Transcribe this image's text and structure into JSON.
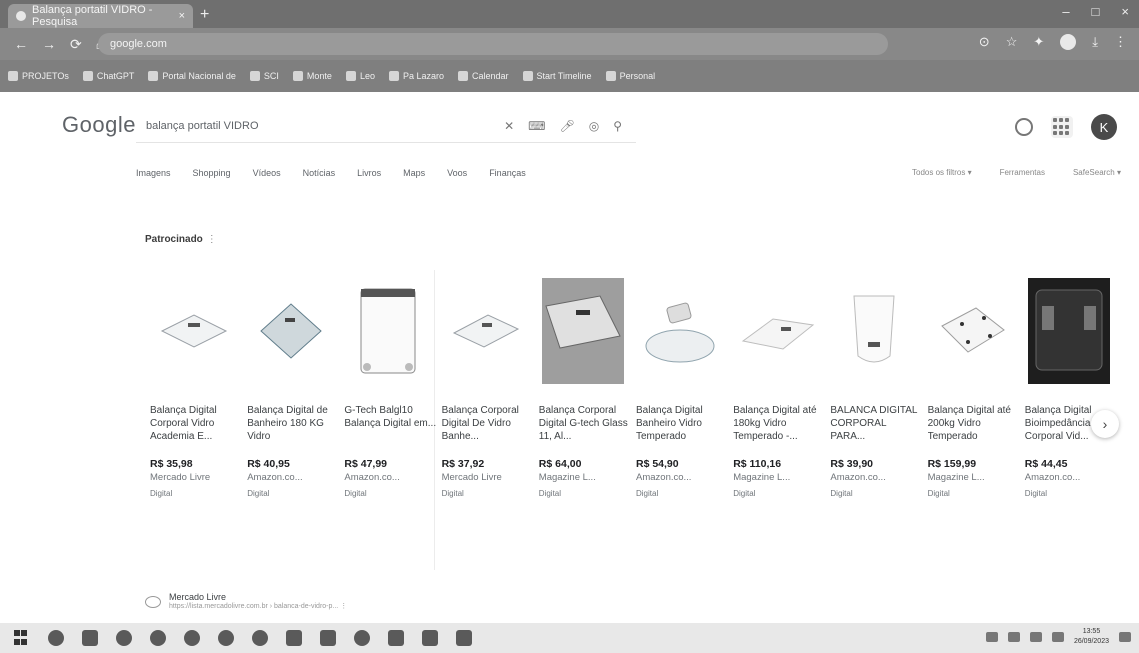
{
  "browser": {
    "tab_title": "Balança portatil VIDRO - Pesquisa",
    "tab_close": "×",
    "new_tab": "+",
    "url": "google.com",
    "window_controls": [
      "–",
      "□",
      "×"
    ],
    "bookmarks": [
      "PROJETOs",
      "ChatGPT",
      "Portal Nacional de",
      "SCI",
      "Monte",
      "Leo",
      "Pa Lazaro",
      "Calendar",
      "Start Timeline",
      "Personal"
    ]
  },
  "google": {
    "logo": "Google",
    "query": "balança portatil VIDRO",
    "avatar_letter": "K",
    "tabs": [
      "Imagens",
      "Shopping",
      "Vídeos",
      "Notícias",
      "Livros",
      "Maps",
      "Voos",
      "Finanças"
    ],
    "tools": [
      "Todos os filtros ▾",
      "Ferramentas"
    ],
    "safesearch": "SafeSearch ▾",
    "sponsored_label": "Patrocinado",
    "sponsored_info": "⋮"
  },
  "products": [
    {
      "title": "Balança Digital Corporal Vidro Academia E...",
      "price": "R$ 35,98",
      "store": "Mercado Livre",
      "tag": "Digital"
    },
    {
      "title": "Balança Digital de Banheiro 180 KG Vidro",
      "price": "R$ 40,95",
      "store": "Amazon.co...",
      "tag": "Digital"
    },
    {
      "title": "G-Tech Balgl10 Balança Digital em...",
      "price": "R$ 47,99",
      "store": "Amazon.co...",
      "tag": "Digital"
    },
    {
      "title": "Balança Corporal Digital De Vidro Banhe...",
      "price": "R$ 37,92",
      "store": "Mercado Livre",
      "tag": "Digital"
    },
    {
      "title": "Balança Corporal Digital G-tech Glass 11, Al...",
      "price": "R$ 64,00",
      "store": "Magazine L...",
      "tag": "Digital"
    },
    {
      "title": "Balança Digital Banheiro Vidro Temperado",
      "price": "R$ 54,90",
      "store": "Amazon.co...",
      "tag": "Digital"
    },
    {
      "title": "Balança Digital até 180kg Vidro Temperado -...",
      "price": "R$ 110,16",
      "store": "Magazine L...",
      "tag": "Digital"
    },
    {
      "title": "BALANCA DIGITAL CORPORAL PARA...",
      "price": "R$ 39,90",
      "store": "Amazon.co...",
      "tag": "Digital"
    },
    {
      "title": "Balança Digital até 200kg Vidro Temperado",
      "price": "R$ 159,99",
      "store": "Magazine L...",
      "tag": "Digital"
    },
    {
      "title": "Balança Digital Bioimpedância Corporal Vid...",
      "price": "R$ 44,45",
      "store": "Amazon.co...",
      "tag": "Digital"
    }
  ],
  "next_arrow": "›",
  "organic": {
    "site": "Mercado Livre",
    "url": "https://lista.mercadolivre.com.br › balanca-de-vidro-p...",
    "menu": "⋮"
  },
  "taskbar": {
    "time": "13:55",
    "date": "26/09/2023"
  }
}
